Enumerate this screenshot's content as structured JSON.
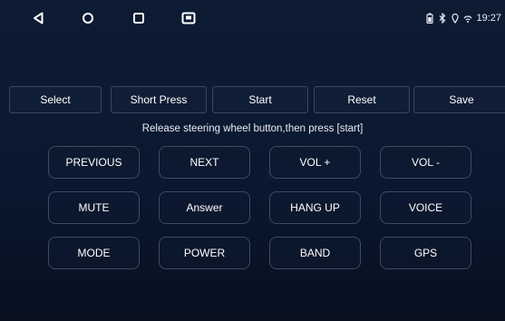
{
  "status_bar": {
    "nav_icons": [
      "back-triangle-icon",
      "home-circle-icon",
      "recents-square-icon",
      "screenshot-icon"
    ],
    "status_icons": [
      "battery-icon",
      "bluetooth-icon",
      "location-icon",
      "wifi-icon"
    ],
    "time": "19:27"
  },
  "toolbar": {
    "select_label": "Select",
    "short_press_label": "Short Press",
    "start_label": "Start",
    "reset_label": "Reset",
    "save_label": "Save"
  },
  "instruction": "Release steering wheel button,then press [start]",
  "keys": {
    "row1": [
      "PREVIOUS",
      "NEXT",
      "VOL +",
      "VOL -"
    ],
    "row2": [
      "MUTE",
      "Answer",
      "HANG UP",
      "VOICE"
    ],
    "row3": [
      "MODE",
      "POWER",
      "BAND",
      "GPS"
    ]
  },
  "colors": {
    "background": "#0a1830",
    "button_border": "#3e4a62",
    "text": "#ffffff"
  }
}
